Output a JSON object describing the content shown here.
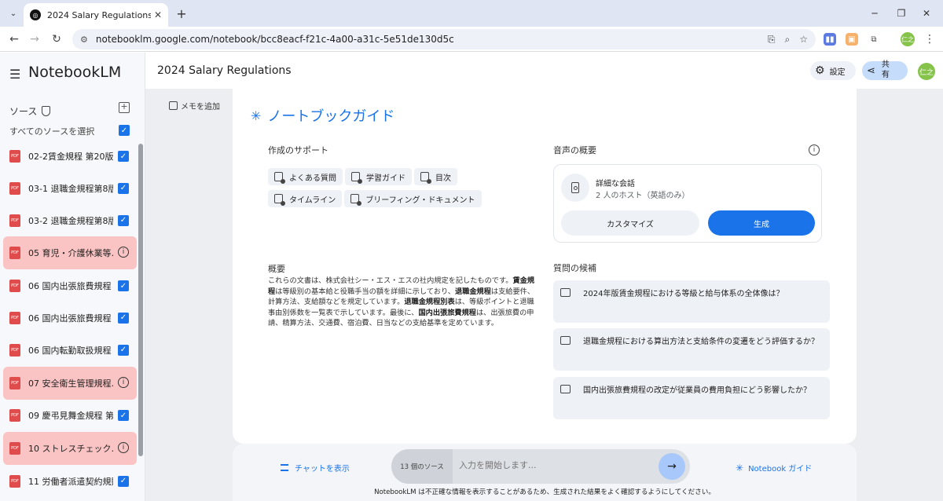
{
  "browser": {
    "tab_title": "2024 Salary Regulations - NotebookLM",
    "url": "notebooklm.google.com/notebook/bcc8eacf-f21c-4a00-a31c-5e51de130d5c",
    "profile_initial": "仁之"
  },
  "app": {
    "title": "NotebookLM",
    "notebook_title": "2024 Salary Regulations",
    "settings_label": "設定",
    "share_label": "共有",
    "avatar_initial": "仁之"
  },
  "sidebar": {
    "sources_heading": "ソース",
    "select_all_label": "すべてのソースを選択",
    "items": [
      {
        "label": "02-2賃金規程 第20版…",
        "status": "checked"
      },
      {
        "label": "03-1 退職金規程第8版…",
        "status": "checked"
      },
      {
        "label": "03-2 退職金規程第8版…",
        "status": "checked"
      },
      {
        "label": "05 育児・介護休業等…",
        "status": "error"
      },
      {
        "label": "06 国内出張旅費規程 …",
        "status": "checked"
      },
      {
        "label": "06 国内出張旅費規程 …",
        "status": "checked"
      },
      {
        "label": "06 国内転勤取扱規程 …",
        "status": "checked"
      },
      {
        "label": "07 安全衛生管理規程…",
        "status": "error"
      },
      {
        "label": "09 慶弔見舞金規程 第…",
        "status": "checked"
      },
      {
        "label": "10 ストレスチェック…",
        "status": "error"
      },
      {
        "label": "11 労働者派遣契約規則…",
        "status": "checked"
      }
    ]
  },
  "main": {
    "add_note_label": "メモを追加",
    "guide_title": "ノートブックガイド",
    "creation_support_label": "作成のサポート",
    "chips": [
      "よくある質問",
      "学習ガイド",
      "目次",
      "タイムライン",
      "ブリーフィング・ドキュメント"
    ],
    "audio_overview_label": "音声の概要",
    "audio": {
      "title": "詳細な会話",
      "subtitle": "2 人のホスト（英語のみ）",
      "customize_label": "カスタマイズ",
      "generate_label": "生成"
    },
    "summary_label": "概要",
    "summary_parts": {
      "p1": "これらの文書は、株式会社シー・エス・エスの社内規定を記したものです。",
      "b1": "賃金規程",
      "p2": "は等級別の基本給と役職手当の額を詳細に示しており、",
      "b2": "退職金規程",
      "p3": "は支給要件、計算方法、支給額などを規定しています。",
      "b3": "退職金規程別表",
      "p4": "は、等級ポイントと退職事由別係数を一覧表で示しています。最後に、",
      "b4": "国内出張旅費規程",
      "p5": "は、出張旅費の申請、精算方法、交通費、宿泊費、日当などの支給基準を定めています。"
    },
    "suggested_questions_label": "質問の候補",
    "questions": [
      "2024年版賃金規程における等級と給与体系の全体像は？",
      "退職金規程における算出方法と支給条件の変遷をどう評価するか？",
      "国内出張旅費規程の改定が従業員の費用負担にどう影響したか？"
    ]
  },
  "chat": {
    "show_chat_label": "チャットを表示",
    "source_count": "13 個のソース",
    "input_placeholder": "入力を開始します...",
    "notebook_guide_label": "Notebook ガイド",
    "disclaimer": "NotebookLM は不正確な情報を表示することがあるため、生成された結果をよく確認するようにしてください。"
  },
  "colors": {
    "accent": "#1a73e8",
    "error_bg": "#fbc4c4",
    "pdf_red": "#e04b4b"
  }
}
